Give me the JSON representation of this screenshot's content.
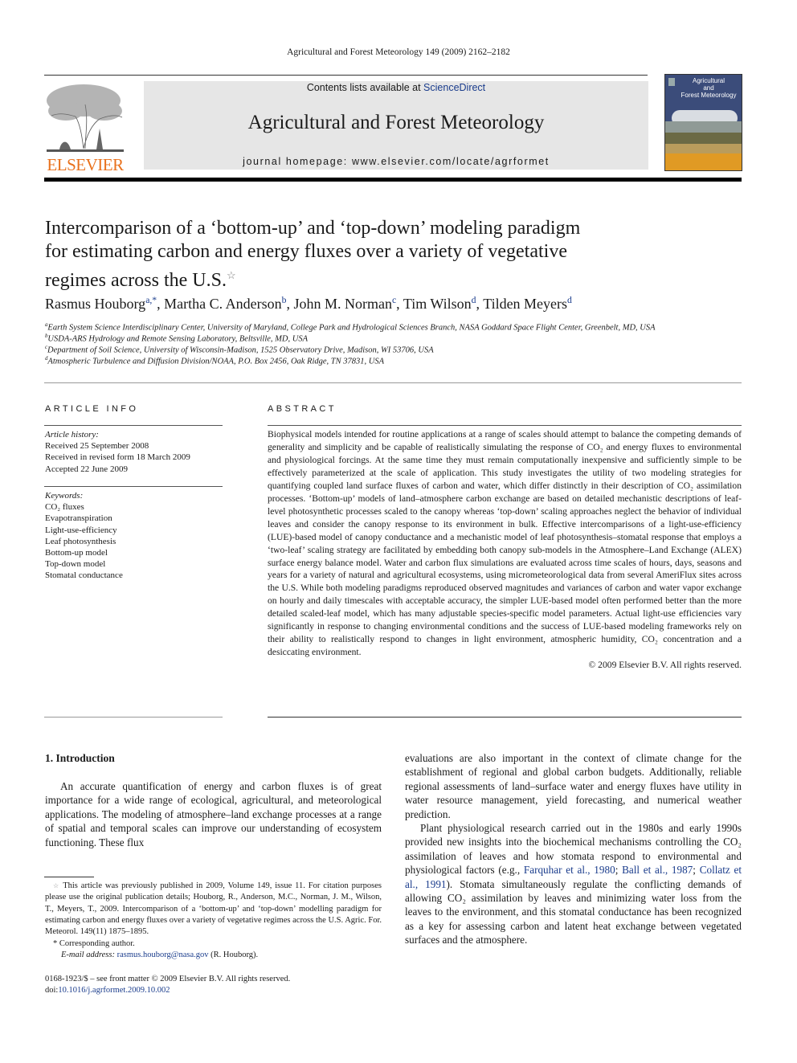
{
  "header": {
    "running_head": "Agricultural and Forest Meteorology 149 (2009) 2162–2182",
    "contents_prefix": "Contents lists available at ",
    "contents_link": "ScienceDirect",
    "journal_title": "Agricultural and Forest Meteorology",
    "homepage": "journal homepage: www.elsevier.com/locate/agrformet",
    "publisher_wordmark": "ELSEVIER",
    "cover_title_line1": "Agricultural",
    "cover_title_line2": "and",
    "cover_title_line3": "Forest Meteorology",
    "colors": {
      "publisher_orange": "#e9711c",
      "link_blue": "#1a3c8c"
    }
  },
  "article": {
    "title_line1": "Intercomparison of a ‘bottom-up’ and ‘top-down’ modeling paradigm",
    "title_line2": "for estimating carbon and energy fluxes over a variety of vegetative",
    "title_line3": "regimes across the U.S.",
    "title_mark": "☆",
    "authors": [
      {
        "name": "Rasmus Houborg",
        "sup": "a,*",
        "sep": ", "
      },
      {
        "name": "Martha C. Anderson",
        "sup": "b",
        "sep": ", "
      },
      {
        "name": "John M. Norman",
        "sup": "c",
        "sep": ", "
      },
      {
        "name": "Tim Wilson",
        "sup": "d",
        "sep": ", "
      },
      {
        "name": "Tilden Meyers",
        "sup": "d",
        "sep": ""
      }
    ],
    "affiliations": [
      {
        "mark": "a",
        "text": "Earth System Science Interdisciplinary Center, University of Maryland, College Park and Hydrological Sciences Branch, NASA Goddard Space Flight Center, Greenbelt, MD, USA"
      },
      {
        "mark": "b",
        "text": "USDA-ARS Hydrology and Remote Sensing Laboratory, Beltsville, MD, USA"
      },
      {
        "mark": "c",
        "text": "Department of Soil Science, University of Wisconsin-Madison, 1525 Observatory Drive, Madison, WI 53706, USA"
      },
      {
        "mark": "d",
        "text": "Atmospheric Turbulence and Diffusion Division/NOAA, P.O. Box 2456, Oak Ridge, TN 37831, USA"
      }
    ]
  },
  "article_info": {
    "heading": "ARTICLE INFO",
    "history_label": "Article history:",
    "history": [
      "Received 25 September 2008",
      "Received in revised form 18 March 2009",
      "Accepted 22 June 2009"
    ],
    "keywords_label": "Keywords:",
    "keywords": [
      "CO₂ fluxes",
      "Evapotranspiration",
      "Light-use-efficiency",
      "Leaf photosynthesis",
      "Bottom-up model",
      "Top-down model",
      "Stomatal conductance"
    ]
  },
  "abstract": {
    "heading": "ABSTRACT",
    "text": "Biophysical models intended for routine applications at a range of scales should attempt to balance the competing demands of generality and simplicity and be capable of realistically simulating the response of CO₂ and energy fluxes to environmental and physiological forcings. At the same time they must remain computationally inexpensive and sufficiently simple to be effectively parameterized at the scale of application. This study investigates the utility of two modeling strategies for quantifying coupled land surface fluxes of carbon and water, which differ distinctly in their description of CO₂ assimilation processes. ‘Bottom-up’ models of land–atmosphere carbon exchange are based on detailed mechanistic descriptions of leaf-level photosynthetic processes scaled to the canopy whereas ‘top-down’ scaling approaches neglect the behavior of individual leaves and consider the canopy response to its environment in bulk. Effective intercomparisons of a light-use-efficiency (LUE)-based model of canopy conductance and a mechanistic model of leaf photosynthesis–stomatal response that employs a ‘two-leaf’ scaling strategy are facilitated by embedding both canopy sub-models in the Atmosphere–Land Exchange (ALEX) surface energy balance model. Water and carbon flux simulations are evaluated across time scales of hours, days, seasons and years for a variety of natural and agricultural ecosystems, using micrometeorological data from several AmeriFlux sites across the U.S. While both modeling paradigms reproduced observed magnitudes and variances of carbon and water vapor exchange on hourly and daily timescales with acceptable accuracy, the simpler LUE-based model often performed better than the more detailed scaled-leaf model, which has many adjustable species-specific model parameters. Actual light-use efficiencies vary significantly in response to changing environmental conditions and the success of LUE-based modeling frameworks rely on their ability to realistically respond to changes in light environment, atmospheric humidity, CO₂ concentration and a desiccating environment.",
    "copyright": "© 2009 Elsevier B.V. All rights reserved."
  },
  "introduction": {
    "heading": "1.  Introduction",
    "left_col": "An accurate quantification of energy and carbon fluxes is of great importance for a wide range of ecological, agricultural, and meteorological applications. The modeling of atmosphere–land exchange processes at a range of spatial and temporal scales can improve our understanding of ecosystem functioning. These flux",
    "right_col_p1": "evaluations are also important in the context of climate change for the establishment of regional and global carbon budgets. Additionally, reliable regional assessments of land–surface water and energy fluxes have utility in water resource management, yield forecasting, and numerical weather prediction.",
    "right_col_p2_a": "Plant physiological research carried out in the 1980s and early 1990s provided new insights into the biochemical mechanisms controlling the CO₂ assimilation of leaves and how stomata respond to environmental and physiological factors (e.g., ",
    "citations": [
      "Farquhar et al., 1980",
      "Ball et al., 1987",
      "Collatz et al., 1991"
    ],
    "right_col_p2_b": "). Stomata simultaneously regulate the conflicting demands of allowing CO₂ assimilation by leaves and minimizing water loss from the leaves to the environment, and this stomatal conductance has been recognized as a key for assessing carbon and latent heat exchange between vegetated surfaces and the atmosphere."
  },
  "footnotes": {
    "star_mark": "☆",
    "star_text": "This article was previously published in 2009, Volume 149, issue 11. For citation purposes please use the original publication details; Houborg, R., Anderson, M.C., Norman, J. M., Wilson, T., Meyers, T., 2009. Intercomparison of a ‘bottom-up’ and ‘top-down’ modelling paradigm for estimating carbon and energy fluxes over a variety of vegetative regimes across the U.S. Agric. For. Meteorol. 149(11) 1875–1895.",
    "corresponding_mark": "*",
    "corresponding_text": "Corresponding author.",
    "email_label": "E-mail address:",
    "email": "rasmus.houborg@nasa.gov",
    "email_suffix": " (R. Houborg).",
    "front_matter": "0168-1923/$ – see front matter © 2009 Elsevier B.V. All rights reserved.",
    "doi_prefix": "doi:",
    "doi": "10.1016/j.agrformet.2009.10.002"
  }
}
